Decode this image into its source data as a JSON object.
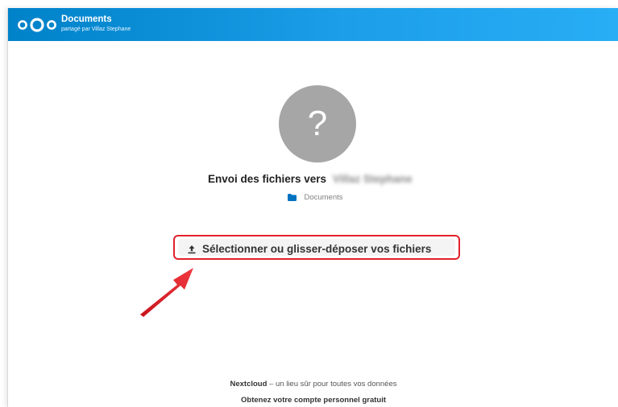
{
  "header": {
    "title": "Documents",
    "subtitle": "partagé par Villaz Stephane",
    "logo_icon": "nextcloud-logo-icon",
    "gradient_start": "#0082c9",
    "gradient_end": "#28aef5"
  },
  "avatar": {
    "glyph": "?",
    "icon": "avatar-placeholder-icon"
  },
  "upload_target": {
    "prefix": "Envoi des fichiers vers",
    "recipient_name": "Villaz Stephane"
  },
  "folder": {
    "icon": "folder-icon",
    "label": "Documents"
  },
  "upload_button": {
    "icon": "upload-icon",
    "label": "Sélectionner ou glisser-déposer vos fichiers",
    "highlight_color": "#e2212b"
  },
  "annotation": {
    "icon": "red-arrow-icon",
    "color": "#e2212b"
  },
  "footer": {
    "brand": "Nextcloud",
    "tagline": " – un lieu sûr pour toutes vos données",
    "cta": "Obtenez votre compte personnel gratuit"
  }
}
